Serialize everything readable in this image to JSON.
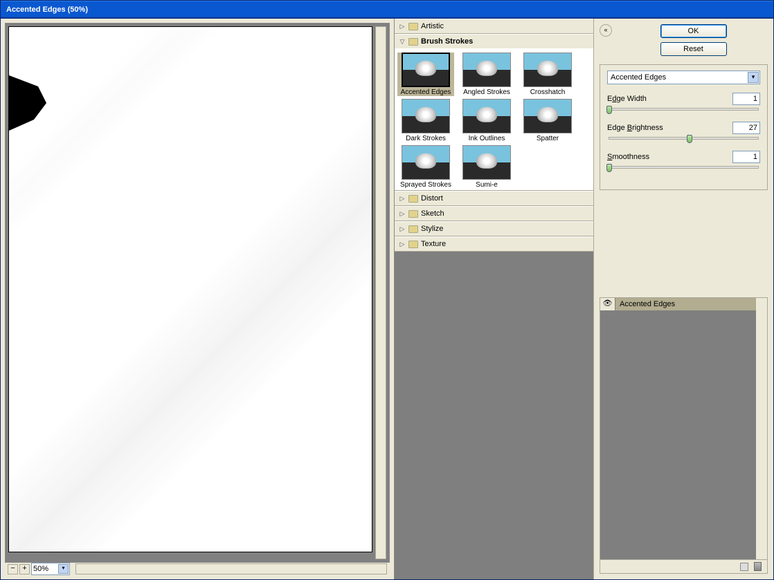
{
  "window": {
    "title": "Accented Edges (50%)"
  },
  "zoom": {
    "value": "50%"
  },
  "buttons": {
    "ok": "OK",
    "reset": "Reset"
  },
  "categories": {
    "artistic": "Artistic",
    "brush": "Brush Strokes",
    "distort": "Distort",
    "sketch": "Sketch",
    "stylize": "Stylize",
    "texture": "Texture"
  },
  "brush_thumbs": [
    {
      "label": "Accented Edges"
    },
    {
      "label": "Angled Strokes"
    },
    {
      "label": "Crosshatch"
    },
    {
      "label": "Dark Strokes"
    },
    {
      "label": "Ink Outlines"
    },
    {
      "label": "Spatter"
    },
    {
      "label": "Sprayed Strokes"
    },
    {
      "label": "Sumi-e"
    }
  ],
  "selected_filter": "Accented Edges",
  "params": {
    "edge_width": {
      "label_pre": "E",
      "label_u": "d",
      "label_post": "ge Width",
      "value": "1",
      "pos": 0
    },
    "edge_brightness": {
      "label_pre": "Edge ",
      "label_u": "B",
      "label_post": "rightness",
      "value": "27",
      "pos": 54
    },
    "smoothness": {
      "label_pre": "",
      "label_u": "S",
      "label_post": "moothness",
      "value": "1",
      "pos": 0
    }
  },
  "layer": {
    "name": "Accented Edges"
  }
}
